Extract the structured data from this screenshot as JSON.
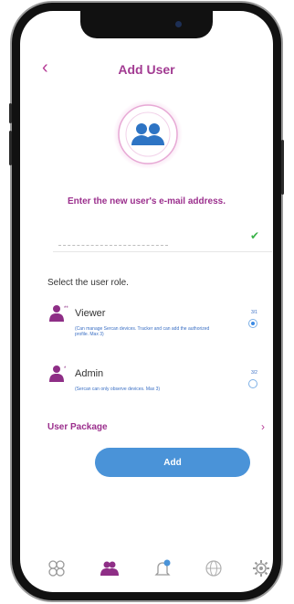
{
  "header": {
    "back_icon": "chevron-left-icon",
    "title": "Add User"
  },
  "avatar_icon": "users-icon",
  "email_prompt": "Enter the new user's e-mail address.",
  "email_field": {
    "value": "",
    "placeholder": ""
  },
  "email_valid_icon": "check-icon",
  "role_heading": "Select the user role.",
  "roles": [
    {
      "name": "Viewer",
      "description": "(Can manage Sercan devices. Tracker and can add the authorized profile. Max 3)",
      "count": "3/1",
      "selected": true,
      "icon": "user-viewer-icon"
    },
    {
      "name": "Admin",
      "description": "(Sercan can only observe devices. Max 3)",
      "count": "3/2",
      "selected": false,
      "icon": "user-admin-icon"
    }
  ],
  "package": {
    "label": "User Package",
    "chevron": "›"
  },
  "add_button": "Add",
  "tabbar": [
    {
      "name": "dashboard",
      "icon": "grid-icon"
    },
    {
      "name": "users",
      "icon": "users-icon",
      "active": true
    },
    {
      "name": "notifications",
      "icon": "bell-icon",
      "badge": "2"
    },
    {
      "name": "web",
      "icon": "globe-icon"
    },
    {
      "name": "settings",
      "icon": "gear-icon"
    }
  ],
  "colors": {
    "accent": "#a23b92",
    "primary": "#4a93d8",
    "check": "#3bb34a",
    "link": "#3a6fc4"
  }
}
